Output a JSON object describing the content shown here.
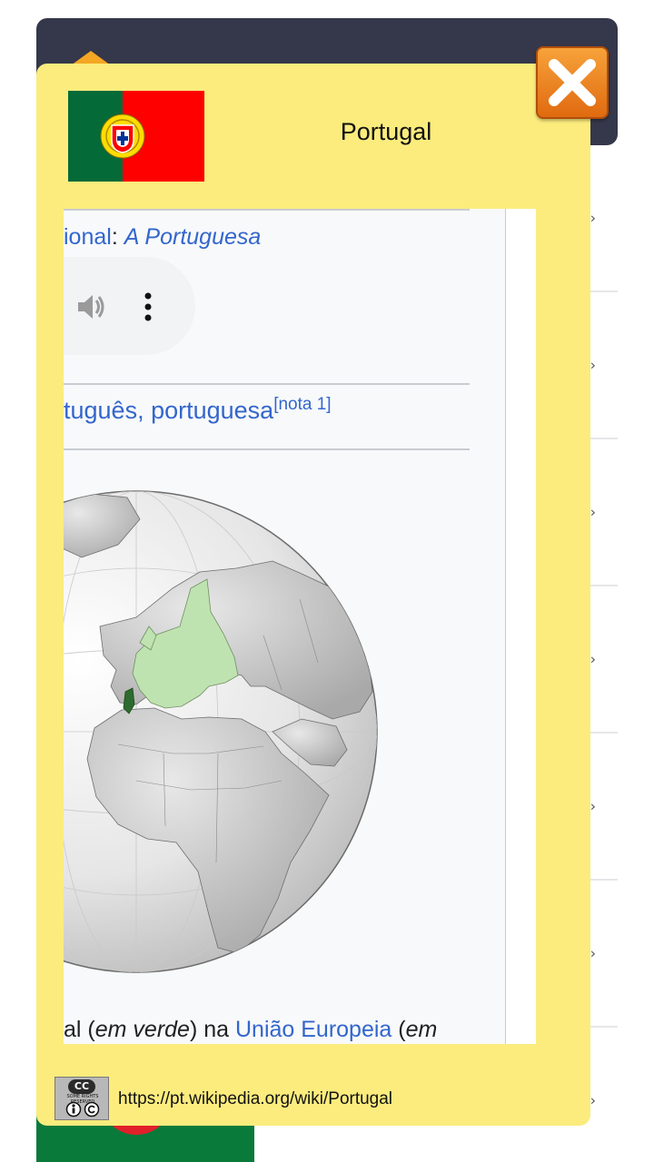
{
  "modal": {
    "title": "Portugal",
    "close_icon": "close-x-icon"
  },
  "infobox": {
    "anthem_prefix": "ional",
    "anthem_separator": ": ",
    "anthem_name": "A Portuguesa",
    "demonym_text": "tuguês, portuguesa",
    "demonym_note": "[nota 1]",
    "caption": {
      "part1": "al (",
      "part2": "em verde",
      "part3": ") na ",
      "link": "União Europeia",
      "part4": " (",
      "part5": "em"
    }
  },
  "badge": {
    "top": "CC",
    "middle": "SOME RIGHTS RESERVED"
  },
  "source_url": "https://pt.wikipedia.org/wiki/Portugal",
  "colors": {
    "modal_bg": "#fbec7d",
    "header_bg": "#35374a",
    "link": "#3366cc",
    "close_button": "#f08a24"
  }
}
